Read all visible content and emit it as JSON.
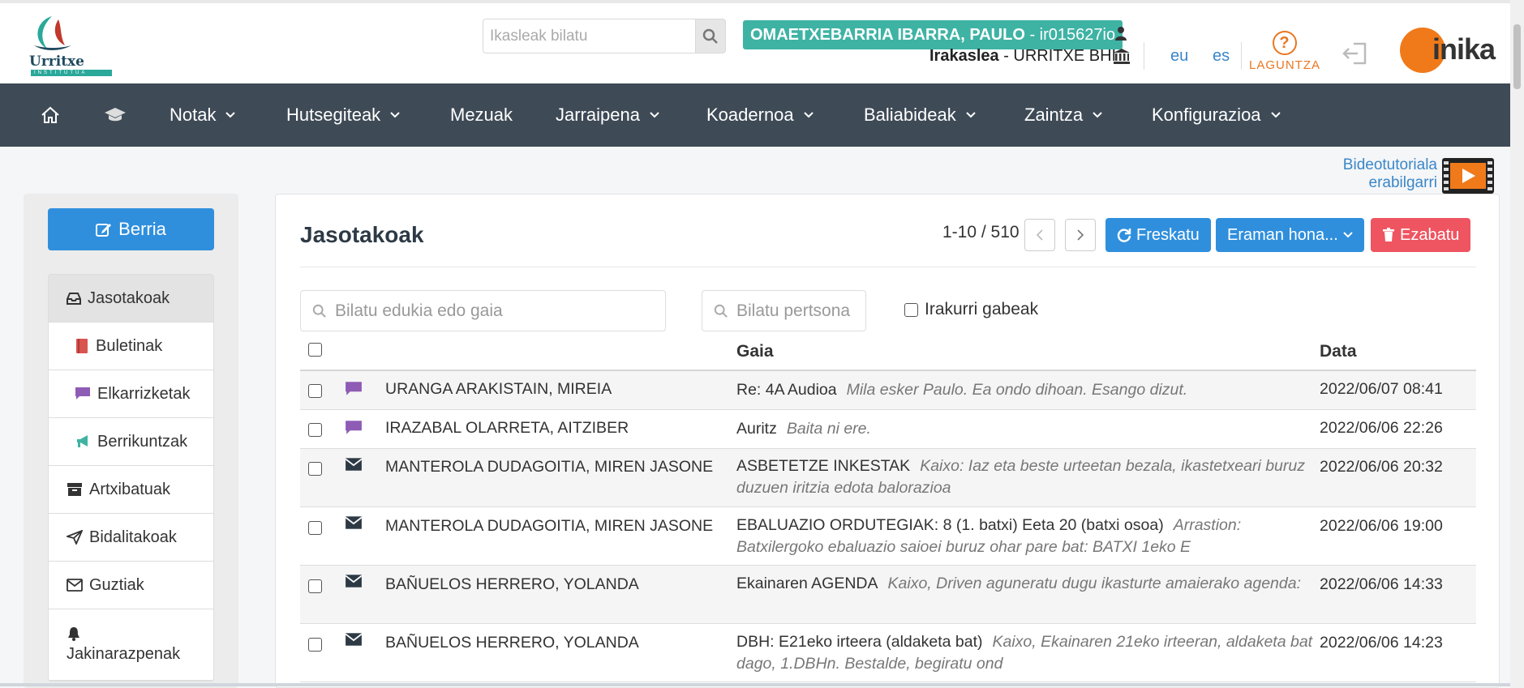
{
  "header": {
    "logo_name": "Urritxe",
    "logo_sub": "INSTITUTUA",
    "search_placeholder": "Ikasleak bilatu",
    "user_name": "OMAETXEBARRIA IBARRA, PAULO",
    "user_id": "ir015627io",
    "role": "Irakaslea",
    "school": "URRITXE BHI",
    "lang_eu": "eu",
    "lang_es": "es",
    "help_label": "LAGUNTZA",
    "brand": "inika"
  },
  "nav": {
    "items": [
      {
        "label": "Notak",
        "has_menu": true
      },
      {
        "label": "Hutsegiteak",
        "has_menu": true
      },
      {
        "label": "Mezuak",
        "has_menu": false
      },
      {
        "label": "Jarraipena",
        "has_menu": true
      },
      {
        "label": "Koadernoa",
        "has_menu": true
      },
      {
        "label": "Baliabideak",
        "has_menu": true
      },
      {
        "label": "Zaintza",
        "has_menu": true
      },
      {
        "label": "Konfigurazioa",
        "has_menu": true
      }
    ]
  },
  "video_tutorial": {
    "line1": "Bideotutoriala",
    "line2": "erabilgarri"
  },
  "sidebar": {
    "new_button": "Berria",
    "items": [
      {
        "label": "Jasotakoak",
        "icon": "inbox-icon",
        "active": true
      },
      {
        "label": "Buletinak",
        "icon": "book-icon"
      },
      {
        "label": "Elkarrizketak",
        "icon": "chat-icon"
      },
      {
        "label": "Berrikuntzak",
        "icon": "megaphone-icon"
      },
      {
        "label": "Artxibatuak",
        "icon": "archive-icon"
      },
      {
        "label": "Bidalitakoak",
        "icon": "send-icon"
      },
      {
        "label": "Guztiak",
        "icon": "envelope-icon"
      },
      {
        "label": "Jakinarazpenak",
        "icon": "bell-icon"
      }
    ]
  },
  "main": {
    "title": "Jasotakoak",
    "pager": "1-10 / 510",
    "refresh_label": "Freskatu",
    "move_label": "Eraman hona...",
    "delete_label": "Ezabatu",
    "search_content_placeholder": "Bilatu edukia edo gaia",
    "search_person_placeholder": "Bilatu pertsona",
    "unread_label": "Irakurri gabeak",
    "col_subject": "Gaia",
    "col_date": "Data",
    "messages": [
      {
        "type": "chat",
        "sender": "URANGA ARAKISTAIN, MIREIA",
        "subject": "Re: 4A Audioa",
        "preview": "Mila esker Paulo. Ea ondo dihoan. Esango dizut.",
        "date": "2022/06/07 08:41"
      },
      {
        "type": "chat",
        "sender": "IRAZABAL OLARRETA, AITZIBER",
        "subject": "Auritz",
        "preview": "Baita ni ere.",
        "date": "2022/06/06 22:26"
      },
      {
        "type": "mail",
        "sender": "MANTEROLA DUDAGOITIA, MIREN JASONE",
        "subject": "ASBETETZE INKESTAK",
        "preview": "Kaixo: Iaz eta beste urteetan bezala, ikastetxeari buruz duzuen iritzia edota balorazioa",
        "date": "2022/06/06 20:32"
      },
      {
        "type": "mail",
        "sender": "MANTEROLA DUDAGOITIA, MIREN JASONE",
        "subject": "EBALUAZIO ORDUTEGIAK: 8 (1. batxi) Eeta 20 (batxi osoa)",
        "preview": "Arrastion: Batxilergoko ebaluazio saioei buruz ohar pare bat: BATXI 1eko E",
        "date": "2022/06/06 19:00"
      },
      {
        "type": "mail",
        "sender": "BAÑUELOS HERRERO, YOLANDA",
        "subject": "Ekainaren AGENDA",
        "preview": "Kaixo, Driven aguneratu dugu ikasturte amaierako agenda:",
        "date": "2022/06/06 14:33"
      },
      {
        "type": "mail",
        "sender": "BAÑUELOS HERRERO, YOLANDA",
        "subject": "DBH: E21eko irteera (aldaketa bat)",
        "preview": "Kaixo, Ekainaren 21eko irteeran, aldaketa bat dago, 1.DBHn. Bestalde, begiratu ond",
        "date": "2022/06/06 14:23"
      }
    ]
  },
  "colors": {
    "nav_bg": "#3e4a56",
    "primary": "#2f8fdd",
    "danger": "#ef5461",
    "user_badge": "#3eb3a4",
    "chat_icon": "#8e5bb5",
    "accent_orange": "#f07a1a"
  }
}
